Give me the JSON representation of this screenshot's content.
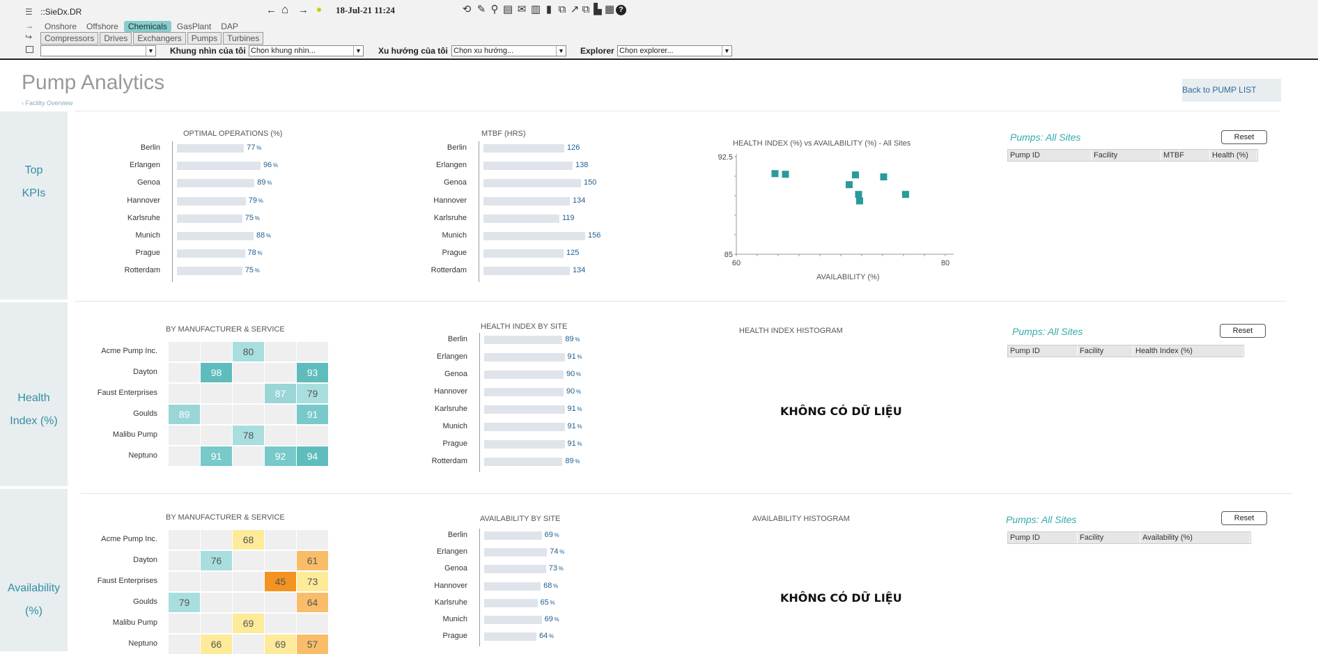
{
  "app_title": "::SieDx.DR",
  "datetime": "18-Jul-21 11:24",
  "top_tabs": [
    "Onshore",
    "Offshore",
    "Chemicals",
    "GasPlant",
    "DAP"
  ],
  "sub_tabs": [
    "Compressors",
    "Drives",
    "Exchangers",
    "Pumps",
    "Turbines"
  ],
  "filters": {
    "first_value": "",
    "view_label": "Khung nhìn của tôi",
    "view_value": "Chọn khung nhìn...",
    "trend_label": "Xu hướng của tôi",
    "trend_value": "Chọn xu hướng...",
    "explorer_label": "Explorer",
    "explorer_value": "Chọn explorer..."
  },
  "page_title": "Pump Analytics",
  "breadcrumb": "Facility Overview",
  "back_link": "Back to PUMP LIST",
  "sections": {
    "kpi": "Top KPIs",
    "health": "Health Index (%)",
    "availability": "Availability (%)"
  },
  "sites": [
    "Berlin",
    "Erlangen",
    "Genoa",
    "Hannover",
    "Karlsruhe",
    "Munich",
    "Prague",
    "Rotterdam"
  ],
  "optimal_ops": {
    "title": "OPTIMAL OPERATIONS (%)",
    "values": [
      77,
      96,
      89,
      79,
      75,
      88,
      78,
      75
    ],
    "unit": "%"
  },
  "mtbf": {
    "title": "MTBF (HRS)",
    "values": [
      126,
      138,
      150,
      134,
      119,
      156,
      125,
      134
    ]
  },
  "scatter": {
    "title": "HEALTH INDEX (%) vs AVAILABILITY (%) - All Sites",
    "xlabel": "AVAILABILITY (%)",
    "x_ticks": [
      "60",
      "80"
    ],
    "y_ticks": [
      "92.5",
      "85"
    ],
    "xlim": [
      60,
      80
    ],
    "ylim": [
      85,
      92.5
    ],
    "points": [
      [
        63.7,
        91.2
      ],
      [
        64.7,
        91.15
      ],
      [
        71.4,
        91.1
      ],
      [
        70.8,
        90.35
      ],
      [
        71.7,
        89.6
      ],
      [
        71.8,
        89.1
      ],
      [
        76.2,
        89.6
      ],
      [
        74.1,
        90.95
      ]
    ]
  },
  "health_heatmap": {
    "title": "BY MANUFACTURER & SERVICE",
    "rows": [
      "Acme Pump Inc.",
      "Dayton",
      "Faust Enterprises",
      "Goulds",
      "Malibu Pump",
      "Neptuno"
    ],
    "cells": [
      [
        null,
        null,
        80,
        null,
        null
      ],
      [
        null,
        98,
        null,
        null,
        93
      ],
      [
        null,
        null,
        null,
        87,
        79
      ],
      [
        89,
        null,
        null,
        null,
        91
      ],
      [
        null,
        null,
        78,
        null,
        null
      ],
      [
        null,
        91,
        null,
        92,
        94
      ]
    ]
  },
  "health_by_site": {
    "title": "HEALTH INDEX BY SITE",
    "values": [
      89,
      91,
      90,
      90,
      91,
      91,
      91,
      89
    ],
    "unit": "%"
  },
  "health_hist": {
    "title": "HEALTH INDEX HISTOGRAM",
    "no_data": "KHÔNG CÓ DỮ LIỆU"
  },
  "avail_heatmap": {
    "title": "BY MANUFACTURER & SERVICE",
    "rows": [
      "Acme Pump Inc.",
      "Dayton",
      "Faust Enterprises",
      "Goulds",
      "Malibu Pump",
      "Neptuno"
    ],
    "cells": [
      [
        null,
        null,
        68,
        null,
        null
      ],
      [
        null,
        76,
        null,
        null,
        61
      ],
      [
        null,
        null,
        null,
        45,
        73
      ],
      [
        79,
        null,
        null,
        null,
        64
      ],
      [
        null,
        null,
        69,
        null,
        null
      ],
      [
        null,
        66,
        null,
        69,
        57
      ]
    ]
  },
  "avail_by_site": {
    "title": "AVAILABILITY BY SITE",
    "values": [
      69,
      74,
      73,
      68,
      65,
      69,
      64
    ],
    "unit": "%"
  },
  "avail_hist": {
    "title": "AVAILABILITY HISTOGRAM",
    "no_data": "KHÔNG CÓ DỮ LIỆU"
  },
  "panels": {
    "title": "Pumps: All Sites",
    "reset": "Reset",
    "kpi_cols": [
      "Pump ID",
      "Facility",
      "MTBF",
      "Health (%)"
    ],
    "health_cols": [
      "Pump ID",
      "Facility",
      "Health Index (%)"
    ],
    "avail_cols": [
      "Pump ID",
      "Facility",
      "Availability (%)"
    ]
  },
  "colors": {
    "accent": "#2f8fa0",
    "bar": "#dfe4ea",
    "value": "#1f5c8e",
    "teal_point": "#2a9a9a"
  }
}
